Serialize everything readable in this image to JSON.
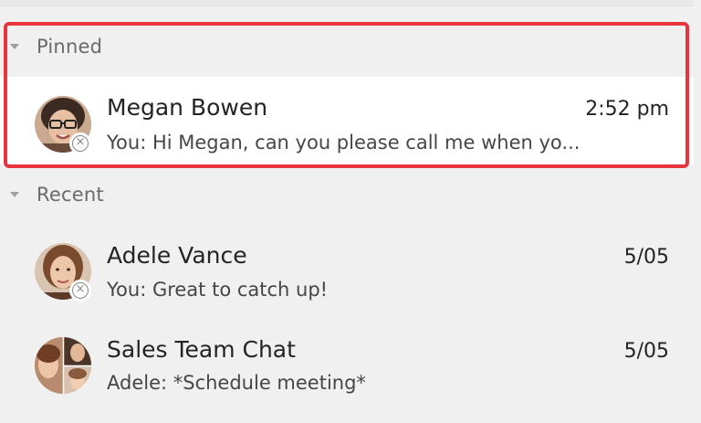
{
  "sections": {
    "pinned": {
      "label": "Pinned",
      "chats": [
        {
          "name": "Megan Bowen",
          "time": "2:52 pm",
          "preview": "You: Hi Megan, can you please call me when yo...",
          "avatar_icon": "person-photo-megan",
          "presence_icon": "offline-presence-icon"
        }
      ]
    },
    "recent": {
      "label": "Recent",
      "chats": [
        {
          "name": "Adele Vance",
          "time": "5/05",
          "preview": "You: Great to catch up!",
          "avatar_icon": "person-photo-adele",
          "presence_icon": "offline-presence-icon"
        },
        {
          "name": "Sales Team Chat",
          "time": "5/05",
          "preview": "Adele: *Schedule meeting*",
          "avatar_icon": "group-photo-collage"
        }
      ]
    }
  },
  "colors": {
    "highlight": "#e8353b",
    "selected_bg": "#ffffff",
    "list_bg": "#f0f0f0"
  }
}
